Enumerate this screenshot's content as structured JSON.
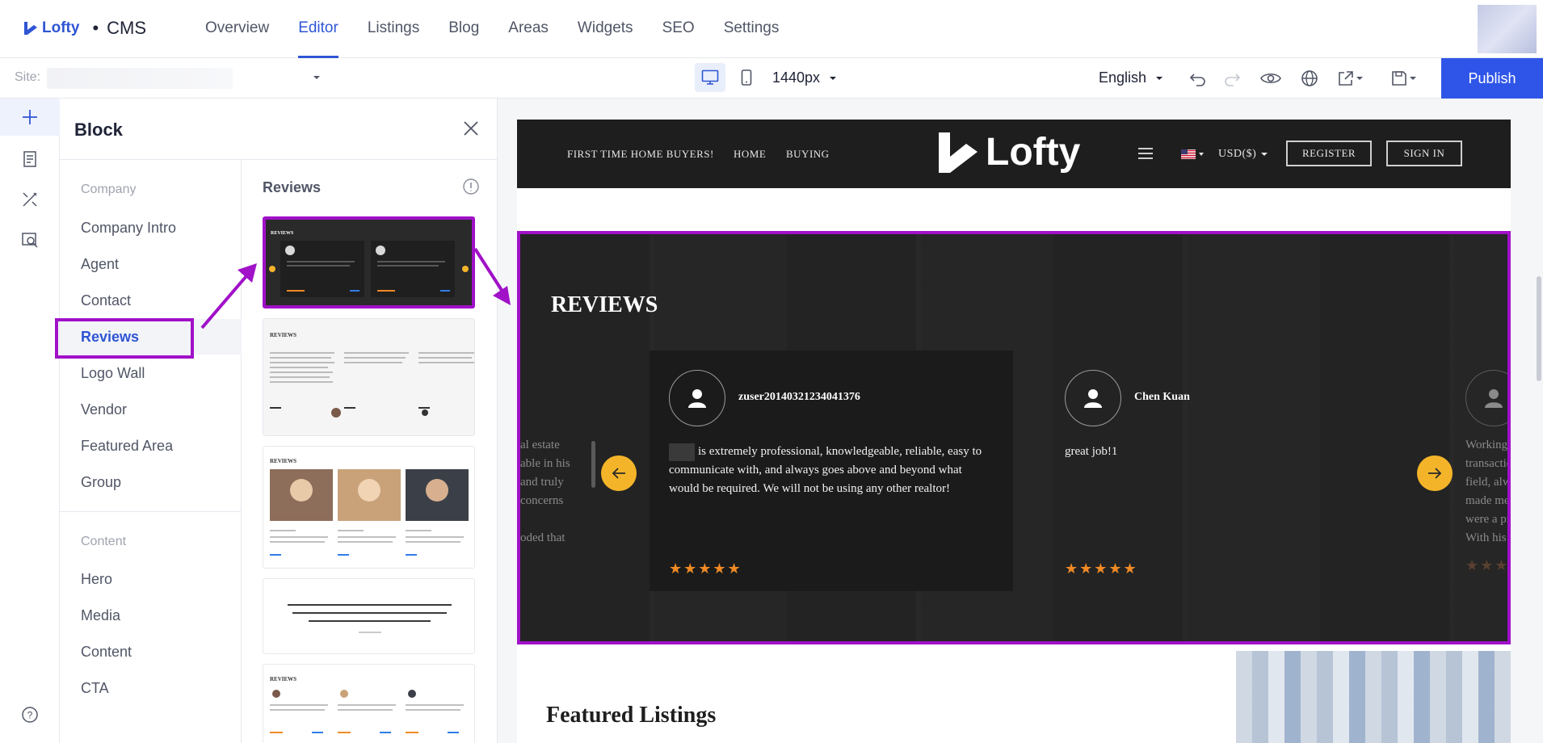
{
  "app": {
    "brand": "Lofty",
    "product": "CMS"
  },
  "nav": {
    "items": [
      {
        "label": "Overview"
      },
      {
        "label": "Editor"
      },
      {
        "label": "Listings"
      },
      {
        "label": "Blog"
      },
      {
        "label": "Areas"
      },
      {
        "label": "Widgets"
      },
      {
        "label": "SEO"
      },
      {
        "label": "Settings"
      }
    ],
    "active": "Editor"
  },
  "toolbar": {
    "site_label": "Site:",
    "width_value": "1440px",
    "language": "English",
    "publish_label": "Publish"
  },
  "block_panel": {
    "title": "Block",
    "group_company": "Company",
    "company_items": [
      "Company Intro",
      "Agent",
      "Contact",
      "Reviews",
      "Logo Wall",
      "Vendor",
      "Featured Area",
      "Group"
    ],
    "group_content": "Content",
    "content_items": [
      "Hero",
      "Media",
      "Content",
      "CTA"
    ],
    "selected": "Reviews",
    "templates_title": "Reviews"
  },
  "preview": {
    "header": {
      "link_first_time": "FIRST TIME HOME BUYERS!",
      "link_home": "HOME",
      "link_buying": "BUYING",
      "logo_text": "Lofty",
      "currency": "USD($)",
      "register": "REGISTER",
      "sign_in": "SIGN IN"
    },
    "reviews": {
      "title": "REVIEWS",
      "cards": [
        {
          "name": "zuser20140321234041376",
          "text": "is extremely professional, knowledgeable, reliable, easy to communicate with, and always goes above and beyond what would be required. We will not be using any other realtor!",
          "stars": "★★★★★"
        },
        {
          "name": "Chen Kuan",
          "text": "great job!1",
          "stars": "★★★★★"
        }
      ],
      "ghost_left": "al estate\nable in his\nand truly\nconcerns\n\noded that",
      "ghost_right": "Working v\ntransactio\nfield, alwa\nmade me\nwere a pri\nWith his e",
      "ghost_stars": "★★★"
    },
    "featured_title": "Featured Listings"
  },
  "colors": {
    "primary": "#2f55e8",
    "highlight": "#a011c8",
    "star": "#f08a24",
    "arrow_button": "#f4b42a"
  }
}
